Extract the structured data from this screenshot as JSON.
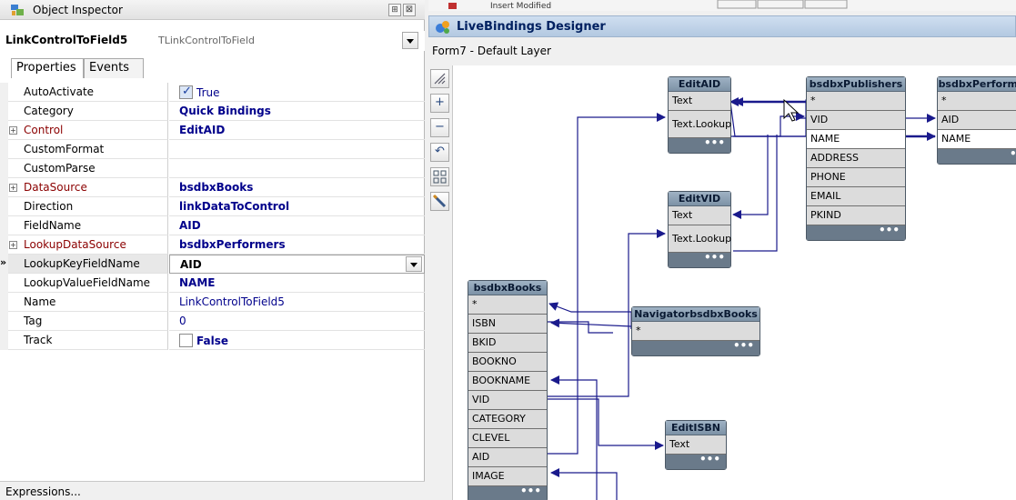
{
  "inspector": {
    "title": "Object Inspector",
    "component_name": "LinkControlToField5",
    "component_class": "TLinkControlToField",
    "tabs": [
      "Properties",
      "Events"
    ],
    "properties": [
      {
        "name": "AutoActivate",
        "value": "True"
      },
      {
        "name": "Category",
        "value": "Quick Bindings"
      },
      {
        "name": "Control",
        "value": "EditAID"
      },
      {
        "name": "CustomFormat",
        "value": ""
      },
      {
        "name": "CustomParse",
        "value": ""
      },
      {
        "name": "DataSource",
        "value": "bsdbxBooks"
      },
      {
        "name": "Direction",
        "value": "linkDataToControl"
      },
      {
        "name": "FieldName",
        "value": "AID"
      },
      {
        "name": "LookupDataSource",
        "value": "bsdbxPerformers"
      },
      {
        "name": "LookupKeyFieldName",
        "value": "AID"
      },
      {
        "name": "LookupValueFieldName",
        "value": "NAME"
      },
      {
        "name": "Name",
        "value": "LinkControlToField5"
      },
      {
        "name": "Tag",
        "value": "0"
      },
      {
        "name": "Track",
        "value": "False"
      }
    ],
    "footer": "Expressions...",
    "icons": {
      "title": "object-inspector-icon",
      "pin": "pin-icon",
      "close": "close-icon"
    }
  },
  "designer": {
    "title": "LiveBindings Designer",
    "subtitle": "Form7  - Default Layer",
    "top_strip": "Insert        Modified",
    "tools": [
      "zoom-fit-icon",
      "zoom-in-icon",
      "zoom-out-icon",
      "undo-icon",
      "layout-icon",
      "wizard-icon"
    ],
    "nodes": {
      "editaid": {
        "title": "EditAID",
        "fields": [
          "Text",
          "Text.Lookup"
        ]
      },
      "editvid": {
        "title": "EditVID",
        "fields": [
          "Text",
          "Text.Lookup"
        ]
      },
      "publishers": {
        "title": "bsdbxPublishers",
        "fields": [
          "*",
          "VID",
          "NAME",
          "ADDRESS",
          "PHONE",
          "EMAIL",
          "PKIND"
        ]
      },
      "performers": {
        "title": "bsdbxPerformers",
        "fields": [
          "*",
          "AID",
          "NAME"
        ]
      },
      "books": {
        "title": "bsdbxBooks",
        "fields": [
          "*",
          "ISBN",
          "BKID",
          "BOOKNO",
          "BOOKNAME",
          "VID",
          "CATEGORY",
          "CLEVEL",
          "AID",
          "IMAGE"
        ]
      },
      "navigator": {
        "title": "NavigatorbsdbxBooks",
        "fields": [
          "*"
        ]
      },
      "editisbn": {
        "title": "EditISBN",
        "fields": [
          "Text"
        ]
      }
    },
    "node_footer": "•••",
    "colors": {
      "link": "#1a1a8c",
      "title_bar": "#b9cde3",
      "node_header": "#8ea3b7",
      "node_body": "#6a7a8a"
    }
  }
}
